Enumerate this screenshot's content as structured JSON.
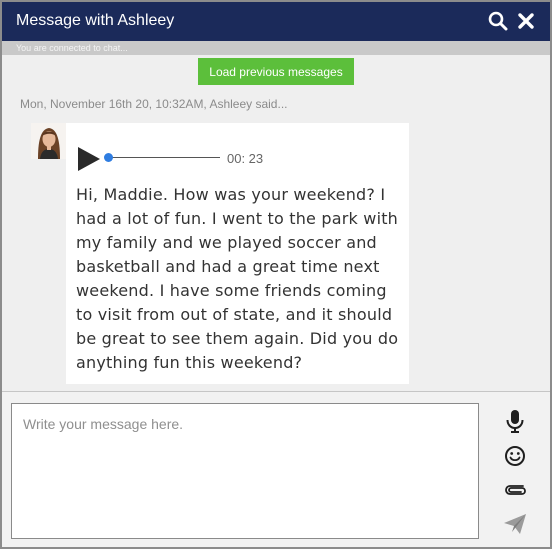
{
  "window": {
    "title": "Message with Ashleey",
    "status": "You are connected to chat..."
  },
  "actions": {
    "load_previous": "Load previous messages"
  },
  "message": {
    "meta": "Mon, November 16th 20, 10:32AM, Ashleey said...",
    "audio": {
      "time": "00: 23",
      "progress": 0
    },
    "text": "Hi, Maddie. How was your weekend? I had a lot of fun. I went to the park with my family and we played soccer and basketball and had a great time next weekend. I have some friends coming to visit from out of state, and it should be great to see them again. Did you do anything fun this weekend?"
  },
  "composer": {
    "placeholder": "Write your message here.",
    "value": ""
  },
  "icons": {
    "search": "search-icon",
    "close": "close-icon",
    "play": "play-icon",
    "microphone": "microphone-icon",
    "emoji": "smiley-icon",
    "attach": "paperclip-icon",
    "send": "send-icon"
  },
  "colors": {
    "titlebar": "#1b2a5a",
    "load_button": "#5cbf3b",
    "audio_knob": "#2f7de1",
    "background": "#efefef"
  }
}
